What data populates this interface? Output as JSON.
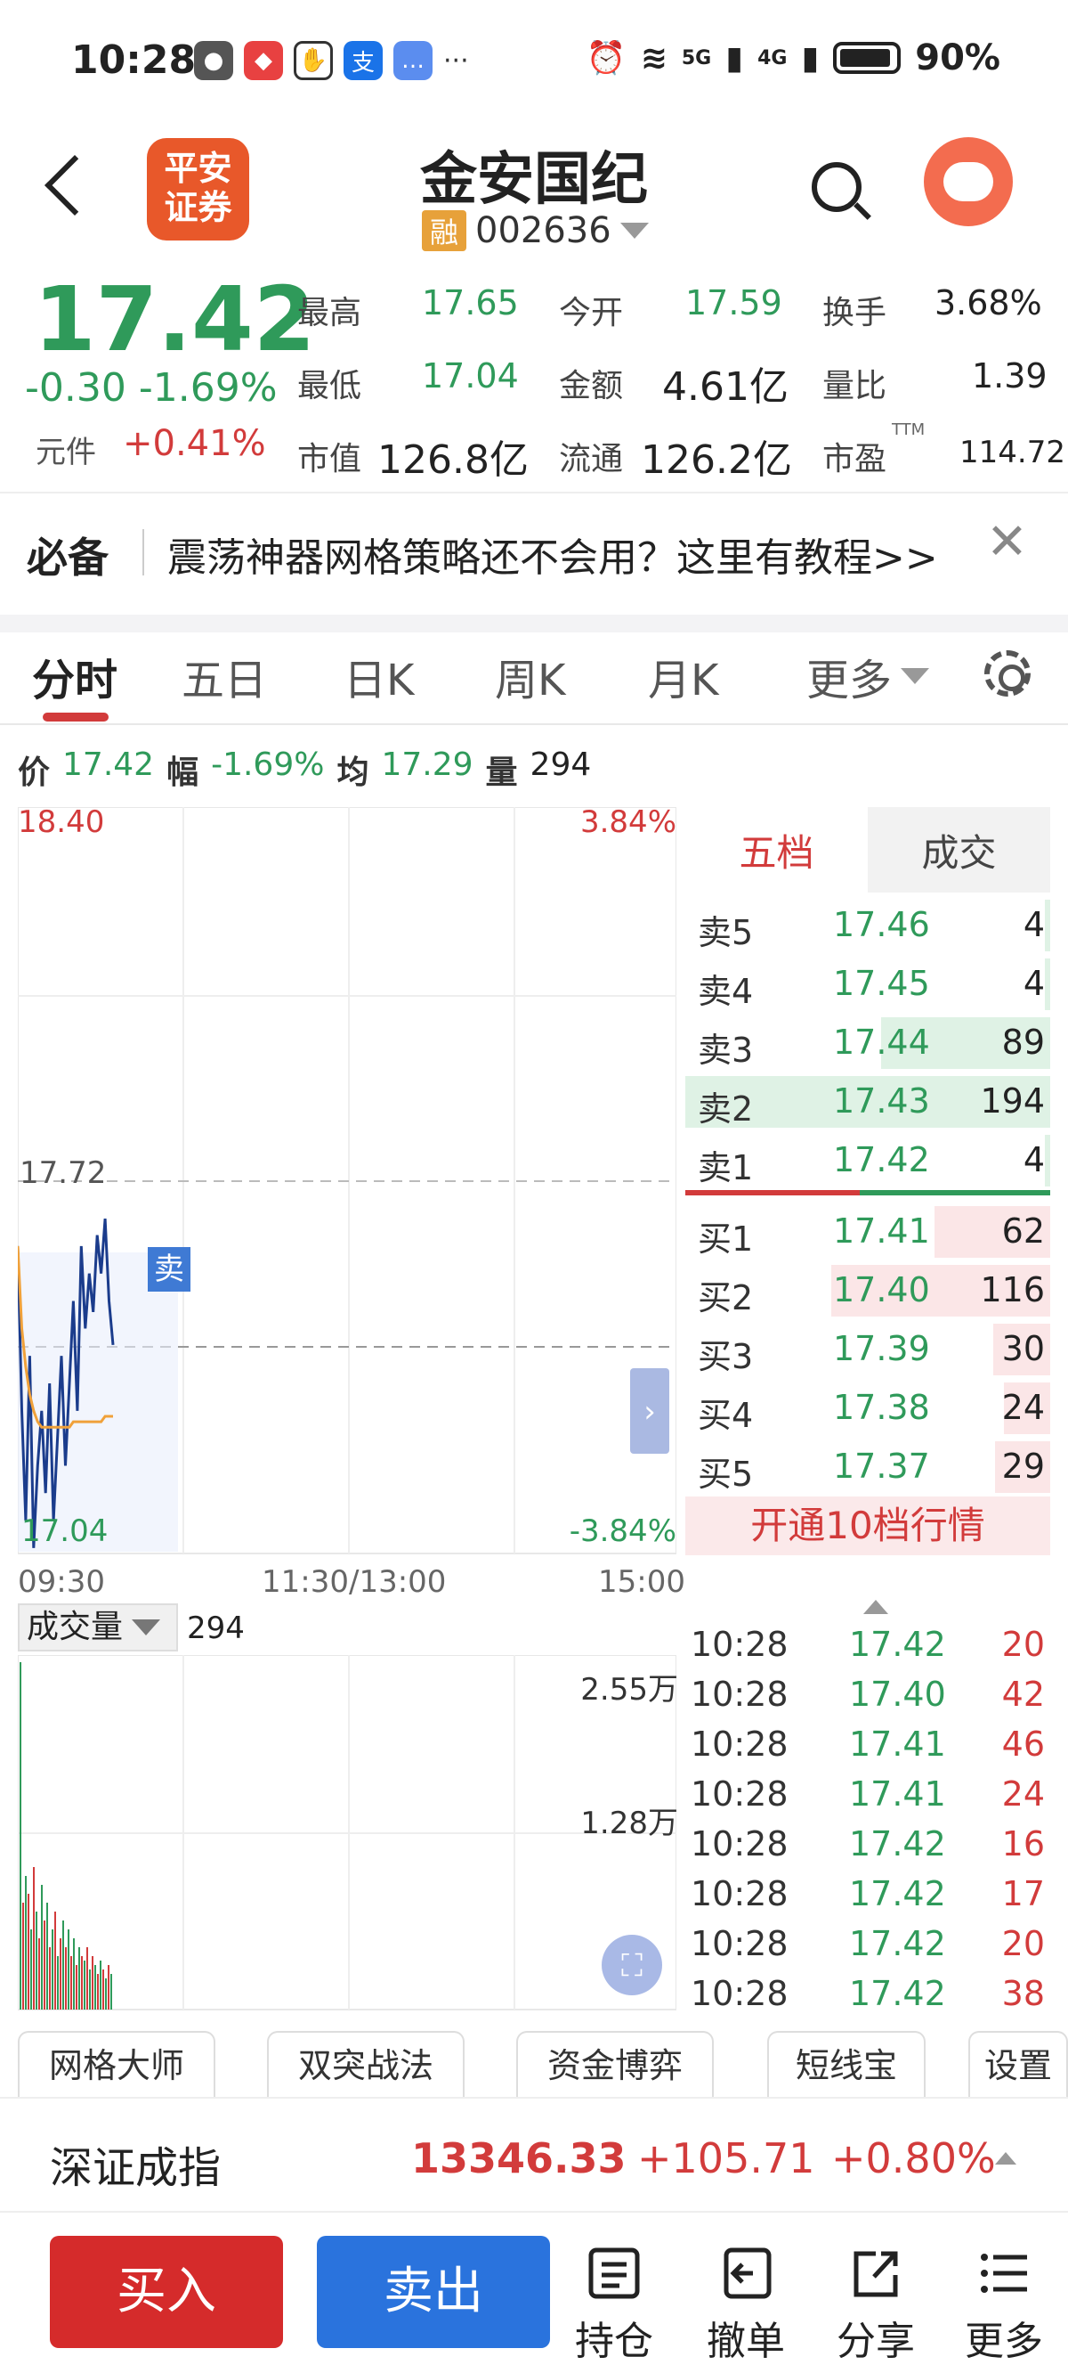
{
  "status_bar": {
    "time": "10:28",
    "battery": "90%",
    "signal1": "5G",
    "signal2": "4G"
  },
  "header": {
    "logo_text": "平安证券",
    "stock_name": "金安国纪",
    "rong_badge": "融",
    "code": "002636"
  },
  "quote": {
    "price": "17.42",
    "change": "-0.30",
    "change_pct": "-1.69%",
    "yuanjian_label": "元件",
    "yuanjian_value": "+0.41%",
    "fields": [
      {
        "label": "最高",
        "value": "17.65",
        "color": "green"
      },
      {
        "label": "今开",
        "value": "17.59",
        "color": "green"
      },
      {
        "label": "换手",
        "value": "3.68%",
        "color": "black"
      },
      {
        "label": "最低",
        "value": "17.04",
        "color": "green"
      },
      {
        "label": "金额",
        "value": "4.61亿",
        "color": "black"
      },
      {
        "label": "量比",
        "value": "1.39",
        "color": "black"
      },
      {
        "label": "市值",
        "value": "126.8亿",
        "color": "black"
      },
      {
        "label": "流通",
        "value": "126.2亿",
        "color": "black"
      },
      {
        "label": "市盈",
        "value": "114.72",
        "color": "black",
        "sup": "TTM"
      }
    ]
  },
  "banner": {
    "badge": "必备",
    "text": "震荡神器网格策略还不会用？这里有教程>>"
  },
  "tabs": [
    {
      "label": "分时"
    },
    {
      "label": "五日"
    },
    {
      "label": "日K"
    },
    {
      "label": "周K"
    },
    {
      "label": "月K"
    },
    {
      "label": "更多"
    }
  ],
  "info_row": {
    "price_label": "价",
    "price": "17.42",
    "range_label": "幅",
    "range": "-1.69%",
    "avg_label": "均",
    "avg": "17.29",
    "vol_label": "量",
    "vol": "294"
  },
  "chart_labels": {
    "high": "18.40",
    "high_pct": "3.84%",
    "mid": "17.72",
    "low": "17.04",
    "low_pct": "-3.84%",
    "sell_marker": "卖",
    "time_start": "09:30",
    "time_mid": "11:30/13:00",
    "time_end": "15:00"
  },
  "chart_data": {
    "type": "line",
    "ylim": [
      17.04,
      18.4
    ],
    "series": [
      {
        "values": [
          17.6,
          17.3,
          17.1,
          17.4,
          17.05,
          17.2,
          17.3,
          17.15,
          17.35,
          17.1,
          17.25,
          17.4,
          17.2,
          17.35,
          17.5,
          17.3,
          17.6,
          17.45,
          17.55,
          17.48,
          17.62,
          17.55,
          17.65,
          17.5,
          17.42
        ]
      },
      {
        "values": [
          17.6,
          17.45,
          17.38,
          17.33,
          17.3,
          17.28,
          17.27,
          17.27,
          17.27,
          17.27,
          17.27,
          17.27,
          17.27,
          17.27,
          17.28,
          17.28,
          17.28,
          17.28,
          17.28,
          17.28,
          17.28,
          17.28,
          17.29,
          17.29,
          17.29
        ]
      }
    ],
    "volume_max_label": "2.55万",
    "volume_mid_label": "1.28万"
  },
  "book": {
    "tab_five": "五档",
    "tab_deals": "成交",
    "sells": [
      {
        "label": "卖5",
        "price": "17.46",
        "vol": "4"
      },
      {
        "label": "卖4",
        "price": "17.45",
        "vol": "4"
      },
      {
        "label": "卖3",
        "price": "17.44",
        "vol": "89"
      },
      {
        "label": "卖2",
        "price": "17.43",
        "vol": "194"
      },
      {
        "label": "卖1",
        "price": "17.42",
        "vol": "4"
      }
    ],
    "buys": [
      {
        "label": "买1",
        "price": "17.41",
        "vol": "62"
      },
      {
        "label": "买2",
        "price": "17.40",
        "vol": "116"
      },
      {
        "label": "买3",
        "price": "17.39",
        "vol": "30"
      },
      {
        "label": "买4",
        "price": "17.38",
        "vol": "24"
      },
      {
        "label": "买5",
        "price": "17.37",
        "vol": "29"
      }
    ],
    "open10": "开通10档行情"
  },
  "volume_panel": {
    "label": "成交量",
    "value": "294"
  },
  "trades": [
    {
      "time": "10:28",
      "price": "17.42",
      "vol": "20"
    },
    {
      "time": "10:28",
      "price": "17.40",
      "vol": "42"
    },
    {
      "time": "10:28",
      "price": "17.41",
      "vol": "46"
    },
    {
      "time": "10:28",
      "price": "17.41",
      "vol": "24"
    },
    {
      "time": "10:28",
      "price": "17.42",
      "vol": "16"
    },
    {
      "time": "10:28",
      "price": "17.42",
      "vol": "17"
    },
    {
      "time": "10:28",
      "price": "17.42",
      "vol": "20"
    },
    {
      "time": "10:28",
      "price": "17.42",
      "vol": "38"
    }
  ],
  "strategies": [
    "网格大师",
    "双突战法",
    "资金博弈",
    "短线宝",
    "设置"
  ],
  "index_bar": {
    "name": "深证成指",
    "value": "13346.33",
    "change": "+105.71",
    "pct": "+0.80%"
  },
  "bottom": {
    "buy": "买入",
    "sell": "卖出",
    "hold": "持仓",
    "cancel": "撤单",
    "share": "分享",
    "more": "更多"
  },
  "colors": {
    "up": "#d23b3b",
    "down": "#2f9a5a",
    "buy_button": "#d52b2b",
    "sell_button": "#2a73dd"
  }
}
